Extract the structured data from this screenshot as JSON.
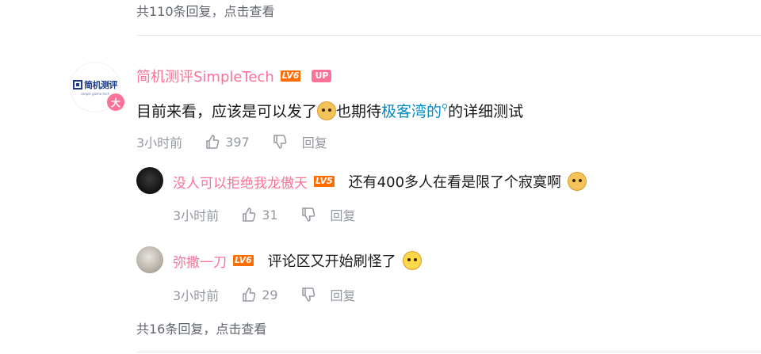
{
  "top_thread": {
    "summary": "共110条回复，点击查看"
  },
  "comment": {
    "username": "简机测评SimpleTech",
    "level": "LV6",
    "up_tag": "UP",
    "avatar_logo_text": "简机测评",
    "avatar_logo_sub": "simple gizmo tech",
    "vip_badge": "大",
    "content_part1": "目前来看，应该是可以发了",
    "content_part2": "也期待",
    "content_link": "极客湾的",
    "content_part3": "的详细测试",
    "time": "3小时前",
    "likes": "397",
    "reply_label": "回复"
  },
  "replies": [
    {
      "username": "没人可以拒绝我龙傲天",
      "level": "LV5",
      "content": "还有400多人在看是限了个寂寞啊",
      "time": "3小时前",
      "likes": "31",
      "reply_label": "回复"
    },
    {
      "username": "弥撒一刀",
      "level": "LV6",
      "content": "评论区又开始刷怪了",
      "time": "3小时前",
      "likes": "29",
      "reply_label": "回复"
    }
  ],
  "bottom_thread": {
    "summary": "共16条回复，点击查看"
  },
  "colors": {
    "accent_pink": "#fb7299",
    "link_blue": "#008ac5",
    "level_orange": "#ff6c00"
  },
  "icons": [
    "thumbs-up-icon",
    "thumbs-down-icon",
    "search-icon",
    "doge-emoji",
    "shock-emoji"
  ]
}
